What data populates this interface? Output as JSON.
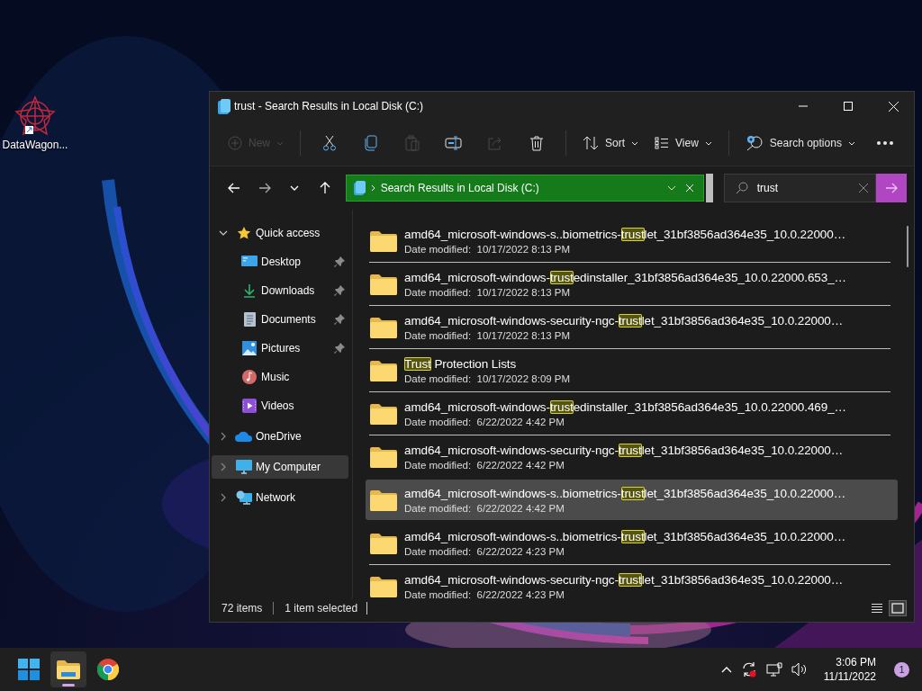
{
  "desktop_icons": [
    {
      "label": "DataWagon..."
    }
  ],
  "window": {
    "title": "trust - Search Results in Local Disk (C:)"
  },
  "toolbar": [
    {
      "kind": "new",
      "label": "New",
      "disabled": true
    },
    {
      "kind": "separator"
    },
    {
      "kind": "cut",
      "disabled": false
    },
    {
      "kind": "copy",
      "disabled": false
    },
    {
      "kind": "paste",
      "disabled": true
    },
    {
      "kind": "rename",
      "disabled": false
    },
    {
      "kind": "share",
      "disabled": true
    },
    {
      "kind": "delete",
      "disabled": false
    },
    {
      "kind": "separator"
    },
    {
      "kind": "sort",
      "label": "Sort",
      "disabled": false
    },
    {
      "kind": "view",
      "label": "View",
      "disabled": false
    },
    {
      "kind": "separator"
    },
    {
      "kind": "search-options",
      "label": "Search options",
      "disabled": false
    },
    {
      "kind": "more",
      "disabled": false
    }
  ],
  "address": {
    "location": "Search Results in Local Disk (C:)"
  },
  "search": {
    "value": "trust"
  },
  "nav": [
    {
      "label": "Quick access",
      "kind": "star",
      "expanded": true,
      "selected": false,
      "children": [
        {
          "label": "Desktop",
          "kind": "desktop",
          "pinned": true,
          "selected": false
        },
        {
          "label": "Downloads",
          "kind": "download",
          "pinned": true,
          "selected": false
        },
        {
          "label": "Documents",
          "kind": "document",
          "pinned": true,
          "selected": false
        },
        {
          "label": "Pictures",
          "kind": "pictures",
          "pinned": true,
          "selected": false
        },
        {
          "label": "Music",
          "kind": "music",
          "pinned": false,
          "selected": false
        },
        {
          "label": "Videos",
          "kind": "video",
          "pinned": false,
          "selected": false
        }
      ]
    },
    {
      "label": "OneDrive",
      "kind": "cloud",
      "expanded": false,
      "selected": false
    },
    {
      "label": "My Computer",
      "kind": "computer",
      "expanded": false,
      "selected": true
    },
    {
      "label": "Network",
      "kind": "network",
      "expanded": false,
      "selected": false
    }
  ],
  "files": [
    {
      "before": "amd64_microsoft-windows-s..biometrics-",
      "match": "trust",
      "after": "let_31bf3856ad364e35_10.0.22000…",
      "date": "Date modified:  10/17/2022 8:13 PM",
      "selected": false
    },
    {
      "before": "amd64_microsoft-windows-",
      "match": "trust",
      "after": "edinstaller_31bf3856ad364e35_10.0.22000.653_…",
      "date": "Date modified:  10/17/2022 8:13 PM",
      "selected": false
    },
    {
      "before": "amd64_microsoft-windows-security-ngc-",
      "match": "trust",
      "after": "let_31bf3856ad364e35_10.0.22000…",
      "date": "Date modified:  10/17/2022 8:13 PM",
      "selected": false
    },
    {
      "match": "Trust",
      "after": " Protection Lists",
      "date": "Date modified:  10/17/2022 8:09 PM",
      "selected": false
    },
    {
      "before": "amd64_microsoft-windows-",
      "match": "trust",
      "after": "edinstaller_31bf3856ad364e35_10.0.22000.469_…",
      "date": "Date modified:  6/22/2022 4:42 PM",
      "selected": false
    },
    {
      "before": "amd64_microsoft-windows-security-ngc-",
      "match": "trust",
      "after": "let_31bf3856ad364e35_10.0.22000…",
      "date": "Date modified:  6/22/2022 4:42 PM",
      "selected": false
    },
    {
      "before": "amd64_microsoft-windows-s..biometrics-",
      "match": "trust",
      "after": "let_31bf3856ad364e35_10.0.22000…",
      "date": "Date modified:  6/22/2022 4:42 PM",
      "selected": true
    },
    {
      "before": "amd64_microsoft-windows-s..biometrics-",
      "match": "trust",
      "after": "let_31bf3856ad364e35_10.0.22000…",
      "date": "Date modified:  6/22/2022 4:23 PM",
      "selected": false
    },
    {
      "before": "amd64_microsoft-windows-security-ngc-",
      "match": "trust",
      "after": "let_31bf3856ad364e35_10.0.22000…",
      "date": "Date modified:  6/22/2022 4:23 PM",
      "selected": false
    }
  ],
  "status_bar": {
    "count": "72 items",
    "selection": "1 item selected"
  },
  "view_modes": [
    {
      "kind": "details",
      "selected": false
    },
    {
      "kind": "tiles",
      "selected": true
    }
  ],
  "taskbar": {
    "apps": [
      {
        "kind": "start",
        "active": false
      },
      {
        "kind": "explorer",
        "active": true
      },
      {
        "kind": "browser",
        "active": false
      }
    ],
    "time": "3:06 PM",
    "date": "11/11/2022",
    "notifications": "1"
  }
}
